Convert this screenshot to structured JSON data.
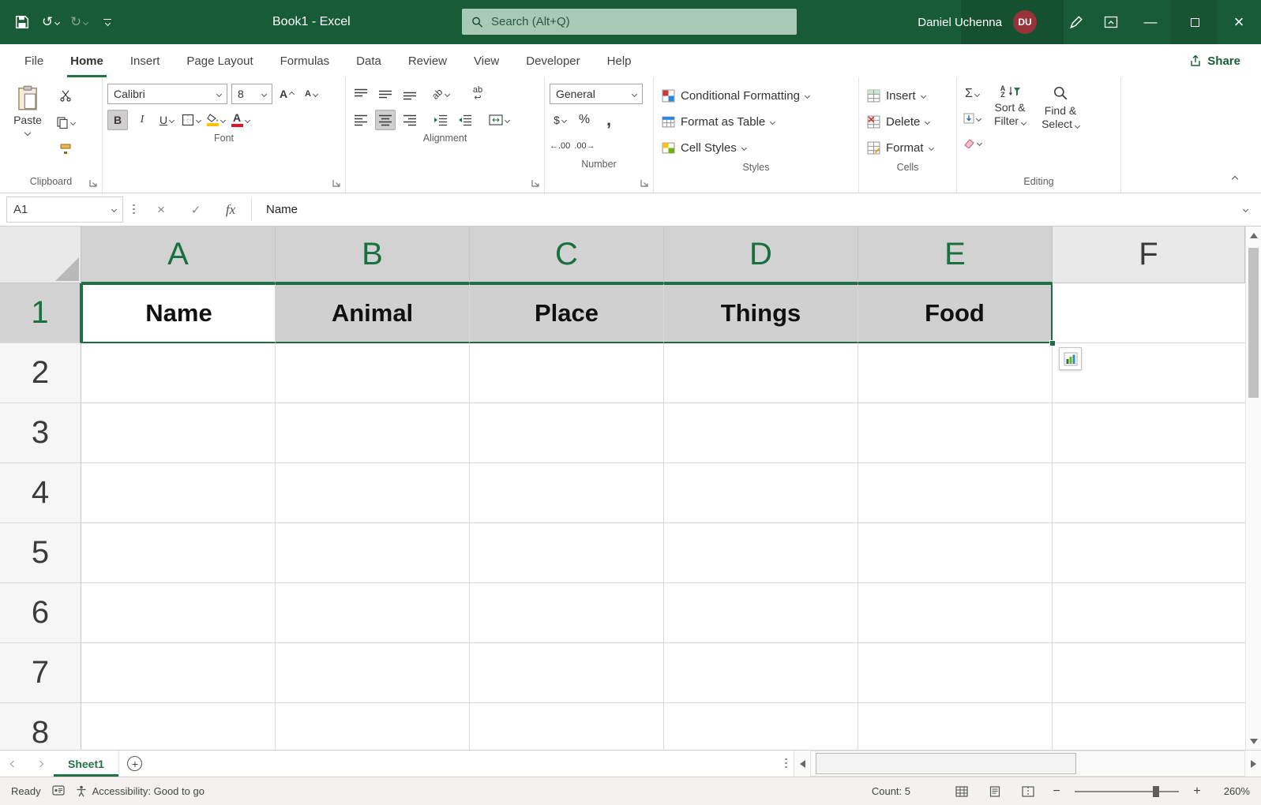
{
  "colors": {
    "titlebar_green": "#185C37",
    "accent_green": "#217346",
    "selection_border_green": "#1F6B43",
    "selected_fill_gray": "#D0D0D0",
    "avatar_red": "#97333B",
    "font_color_red": "#E81123",
    "fill_color_yellow": "#FFC000"
  },
  "icons": {
    "undo": "↺",
    "redo": "↻",
    "minimize": "—",
    "close": "×",
    "check": "✓",
    "cross": "×",
    "plus": "+",
    "wrap_arrow": "↩"
  },
  "titlebar": {
    "title": "Book1  -  Excel",
    "search_placeholder": "Search (Alt+Q)",
    "user_name": "Daniel Uchenna",
    "user_initials": "DU"
  },
  "menu": {
    "tabs": [
      "File",
      "Home",
      "Insert",
      "Page Layout",
      "Formulas",
      "Data",
      "Review",
      "View",
      "Developer",
      "Help"
    ],
    "active_tab": "Home",
    "share_label": "Share"
  },
  "ribbon": {
    "clipboard": {
      "paste": "Paste",
      "label": "Clipboard"
    },
    "font": {
      "family": "Calibri",
      "size": "8",
      "grow": "A",
      "shrink": "A",
      "bold": "B",
      "italic": "I",
      "underline": "U",
      "color_letter": "A",
      "label": "Font"
    },
    "alignment": {
      "orientation": "ab",
      "wrap": "ab",
      "label": "Alignment"
    },
    "number": {
      "format": "General",
      "currency": "$",
      "percent": "%",
      "comma": ",",
      "inc_decimal": "←.00",
      "dec_decimal": ".00→",
      "label": "Number"
    },
    "styles": {
      "conditional": "Conditional Formatting",
      "format_table": "Format as Table",
      "cell_styles": "Cell Styles",
      "label": "Styles"
    },
    "cells": {
      "insert": "Insert",
      "delete": "Delete",
      "format": "Format",
      "label": "Cells"
    },
    "editing": {
      "autosum": "Σ",
      "sort_letters": "A Z",
      "sort_filter": "Sort & Filter",
      "find_select": "Find & Select",
      "label": "Editing"
    }
  },
  "formula_bar": {
    "name_box": "A1",
    "fx": "fx",
    "content": "Name"
  },
  "sheet": {
    "columns": [
      "A",
      "B",
      "C",
      "D",
      "E",
      "F"
    ],
    "rows": [
      "1",
      "2",
      "3",
      "4",
      "5",
      "6",
      "7",
      "8"
    ],
    "cells": {
      "A1": "Name",
      "B1": "Animal",
      "C1": "Place",
      "D1": "Things",
      "E1": "Food"
    }
  },
  "sheet_tabs": {
    "sheet1": "Sheet1"
  },
  "status_bar": {
    "mode": "Ready",
    "accessibility": "Accessibility: Good to go",
    "count": "Count: 5",
    "zoom_out": "−",
    "zoom_in": "+",
    "zoom_level": "260%"
  }
}
